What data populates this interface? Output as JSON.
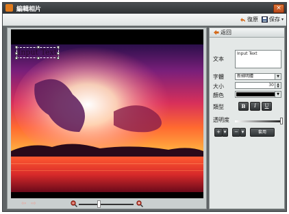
{
  "window": {
    "title": "編輯相片",
    "close_label": "×"
  },
  "toolbar": {
    "undo_label": "復原",
    "save_label": "保存"
  },
  "photo": {
    "overlay_text": "Input Text"
  },
  "panel": {
    "back_label": "返回",
    "text_label": "文本",
    "text_value": "Input Text",
    "font_label": "字體",
    "font_value": "新細明體",
    "size_label": "大小",
    "size_value": "30",
    "color_label": "顏色",
    "color_value": "#000000",
    "style_label": "類型",
    "bold_label": "B",
    "italic_label": "I",
    "underline_label": "U",
    "opacity_label": "透明度",
    "opacity_value": 1.0,
    "add_label": "+",
    "remove_label": "−",
    "apply_label": "套用"
  },
  "zoom": {
    "level": 0.35
  },
  "colors": {
    "window_bg": "#5f6466",
    "panel_bg": "#e4e8e7",
    "accent": "#e07b1d"
  }
}
